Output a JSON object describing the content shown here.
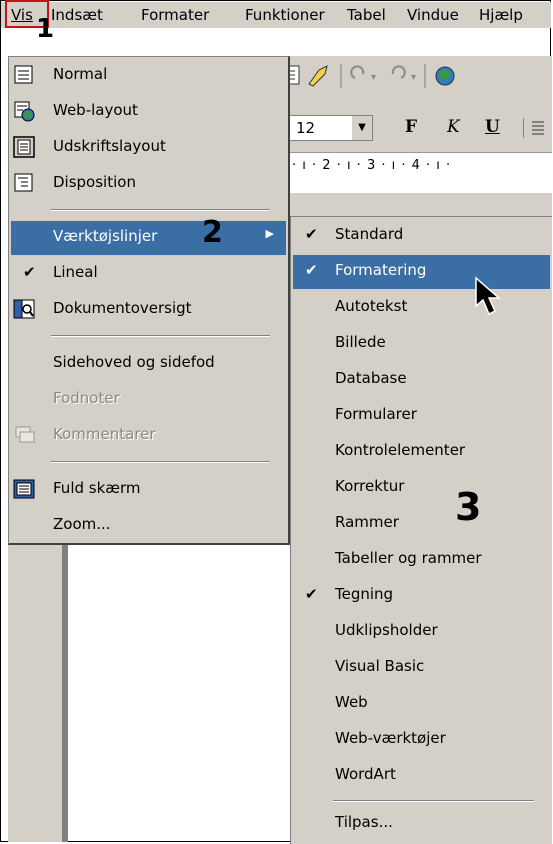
{
  "menubar": {
    "items": [
      "Vis",
      "Indsæt",
      "Formater",
      "Funktioner",
      "Tabel",
      "Vindue",
      "Hjælp"
    ]
  },
  "steps": [
    "1",
    "2",
    "3"
  ],
  "toolbar": {
    "font_size": "12",
    "bold": "F",
    "italic": "K",
    "underline": "U"
  },
  "ruler": {
    "text": "·  ı  ·  2  ·  ı  ·  3  ·  ı  ·  4  ·  ı  ·"
  },
  "vis_menu": {
    "normal": "Normal",
    "web_layout": "Web-layout",
    "print_layout": "Udskriftslayout",
    "outline": "Disposition",
    "toolbars": "Værktøjslinjer",
    "ruler": "Lineal",
    "document_map": "Dokumentoversigt",
    "header_footer": "Sidehoved og sidefod",
    "footnotes": "Fodnoter",
    "comments": "Kommentarer",
    "full_screen": "Fuld skærm",
    "zoom": "Zoom..."
  },
  "toolbars_menu": {
    "items": [
      {
        "label": "Standard",
        "checked": true
      },
      {
        "label": "Formatering",
        "checked": true
      },
      {
        "label": "Autotekst",
        "checked": false
      },
      {
        "label": "Billede",
        "checked": false
      },
      {
        "label": "Database",
        "checked": false
      },
      {
        "label": "Formularer",
        "checked": false
      },
      {
        "label": "Kontrolelementer",
        "checked": false
      },
      {
        "label": "Korrektur",
        "checked": false
      },
      {
        "label": "Rammer",
        "checked": false
      },
      {
        "label": "Tabeller og rammer",
        "checked": false
      },
      {
        "label": "Tegning",
        "checked": true
      },
      {
        "label": "Udklipsholder",
        "checked": false
      },
      {
        "label": "Visual Basic",
        "checked": false
      },
      {
        "label": "Web",
        "checked": false
      },
      {
        "label": "Web-værktøjer",
        "checked": false
      },
      {
        "label": "WordArt",
        "checked": false
      }
    ],
    "customize": "Tilpas..."
  },
  "colors": {
    "menu_bg": "#d4d0c8",
    "highlight": "#3a6ea5",
    "marker": "#c0141a"
  }
}
